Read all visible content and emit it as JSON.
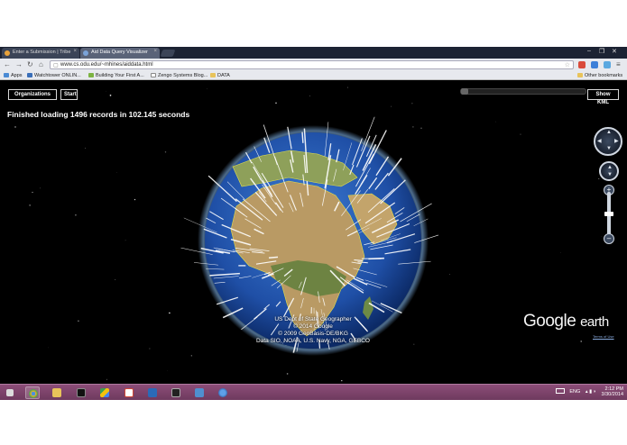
{
  "browser": {
    "tabs": [
      {
        "label": "Enter a Submission | Tribe"
      },
      {
        "label": "Aid Data Query Visualizer"
      }
    ],
    "url": "www.cs.odu.edu/~mhines/aiddata.html",
    "bookmarks": [
      {
        "label": "Apps"
      },
      {
        "label": "Watchtower ONLIN..."
      },
      {
        "label": "Building Your First A..."
      },
      {
        "label": "Zengo Systems Blog..."
      },
      {
        "label": "DATA"
      },
      {
        "label": "Other bookmarks"
      }
    ]
  },
  "app": {
    "organizations_button": "Organizations",
    "start_button": "Start",
    "show_kml_button": "Show KML",
    "status_message": "Finished loading 1496 records in 102.145 seconds"
  },
  "map": {
    "attribution_lines": [
      "US Dept of State Geographer",
      "© 2014 Google",
      "© 2009 GeoBasis-DE/BKG",
      "Data SIO, NOAA, U.S. Navy, NGA, GEBCO"
    ],
    "logo_google": "Google",
    "logo_earth": "earth",
    "terms": "Terms of Use"
  },
  "taskbar": {
    "language": "ENG",
    "time": "2:12 PM",
    "date": "3/30/2014"
  },
  "colors": {
    "taskbar": "#7c4469",
    "ocean": "#1f4fa6",
    "land": "#b99a64",
    "spikes": "#ffffff",
    "borders": "#e6e04a"
  }
}
